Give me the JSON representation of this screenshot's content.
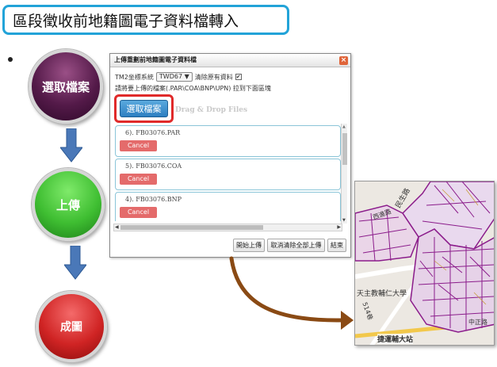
{
  "slide": {
    "title": "區段徵收前地籍圖電子資料檔轉入",
    "steps": [
      {
        "label": "選取檔案",
        "color": "#541a49"
      },
      {
        "label": "上傳",
        "color": "#3fbe32"
      },
      {
        "label": "成圖",
        "color": "#d02424"
      }
    ]
  },
  "dialog": {
    "title": "上傳重劃前地籍圖電子資料檔",
    "close_label": "×",
    "coord_label": "TM2坐標系統",
    "coord_value": "TWD67 ▼",
    "clear_label": "清除原有資料",
    "clear_checked": "✔",
    "hint": "請將要上傳的檔案(.PAR\\COA\\BNP\\UPN) 拉到下面區塊",
    "select_button": "選取檔案",
    "dnd_text": "Drag & Drop Files",
    "files": [
      {
        "name": "6). FB03076.PAR",
        "cancel": "Cancel"
      },
      {
        "name": "5). FB03076.COA",
        "cancel": "Cancel"
      },
      {
        "name": "4). FB03076.BNP",
        "cancel": "Cancel"
      }
    ],
    "scroll_up": "▲",
    "scroll_down": "▼",
    "scroll_left": "◀",
    "scroll_right": "▶",
    "buttons": {
      "start_upload": "開始上傳",
      "cancel_all": "取消清除全部上傳",
      "close": "結束"
    }
  },
  "map": {
    "labels": {
      "road_1": "民生路",
      "road_2": "西進路",
      "school": "天主教輔仁大學",
      "station": "捷運輔大站",
      "road_num": "514巷",
      "road_3": "中正路"
    }
  }
}
